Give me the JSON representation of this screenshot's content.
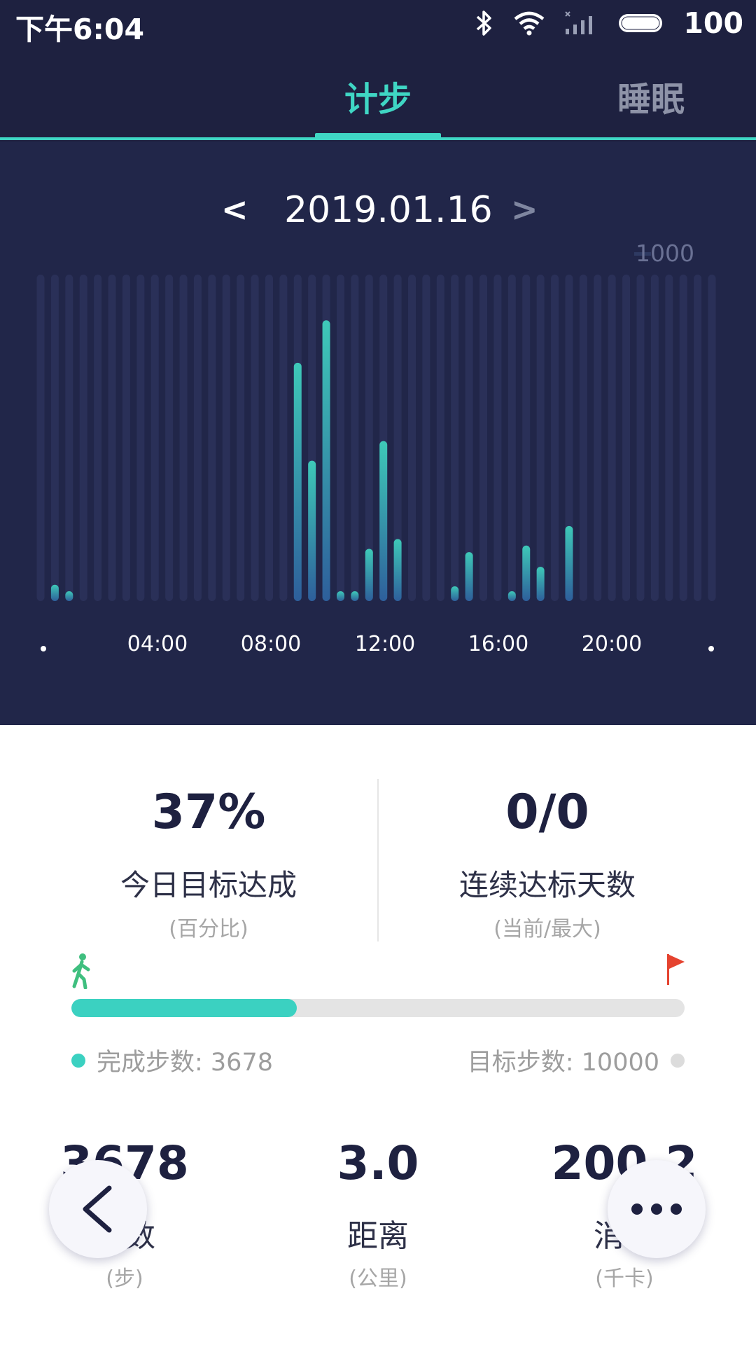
{
  "status_bar": {
    "time": "下午6:04",
    "battery": "100"
  },
  "tabs": [
    {
      "label": "计步"
    },
    {
      "label": "睡眠"
    }
  ],
  "date_nav": {
    "prev": "<",
    "date": "2019.01.16",
    "next": ">"
  },
  "chart": {
    "y_max_label": "1000",
    "x_ticks": [
      "04:00",
      "08:00",
      "12:00",
      "16:00",
      "20:00"
    ],
    "colors": {
      "bar_top": "#3ec9b8",
      "bar_bottom": "#2e5f9b",
      "track": "#2a3058"
    }
  },
  "chart_data": {
    "type": "bar",
    "x": [
      "00:00",
      "00:30",
      "01:00",
      "01:30",
      "02:00",
      "02:30",
      "03:00",
      "03:30",
      "04:00",
      "04:30",
      "05:00",
      "05:30",
      "06:00",
      "06:30",
      "07:00",
      "07:30",
      "08:00",
      "08:30",
      "09:00",
      "09:30",
      "10:00",
      "10:30",
      "11:00",
      "11:30",
      "12:00",
      "12:30",
      "13:00",
      "13:30",
      "14:00",
      "14:30",
      "15:00",
      "15:30",
      "16:00",
      "16:30",
      "17:00",
      "17:30",
      "18:00",
      "18:30",
      "19:00",
      "19:30",
      "20:00",
      "20:30",
      "21:00",
      "21:30",
      "22:00",
      "22:30",
      "23:00",
      "23:30"
    ],
    "values": [
      0,
      50,
      30,
      0,
      0,
      0,
      0,
      0,
      0,
      0,
      0,
      0,
      0,
      0,
      0,
      0,
      0,
      0,
      730,
      430,
      860,
      30,
      30,
      160,
      490,
      190,
      0,
      0,
      0,
      45,
      150,
      0,
      0,
      30,
      170,
      105,
      0,
      230,
      0,
      0,
      0,
      0,
      0,
      0,
      0,
      0,
      0,
      0
    ],
    "xlabel": "",
    "ylabel": "",
    "ylim": [
      0,
      1000
    ],
    "x_ticks": [
      "04:00",
      "08:00",
      "12:00",
      "16:00",
      "20:00"
    ]
  },
  "summary": {
    "goal_percent": {
      "value": "37%",
      "label": "今日目标达成",
      "unit": "(百分比)"
    },
    "streak": {
      "value": "0/0",
      "label": "连续达标天数",
      "unit": "(当前/最大)"
    }
  },
  "progress": {
    "fraction": 0.3678,
    "done_label": "完成步数: 3678",
    "goal_label": "目标步数: 10000",
    "colors": {
      "fill": "#3bd1c1",
      "track": "#e4e4e4",
      "goal_dot": "#dcdcdc"
    }
  },
  "metrics": [
    {
      "value": "3678",
      "label": "步数",
      "unit": "(步)"
    },
    {
      "value": "3.0",
      "label": "距离",
      "unit": "(公里)"
    },
    {
      "value": "200.2",
      "label": "消耗",
      "unit": "(千卡)"
    }
  ],
  "icons": {
    "back": "chevron-left-icon",
    "more": "more-horizontal-icon",
    "walker": "walking-person-icon",
    "flag": "goal-flag-icon"
  }
}
